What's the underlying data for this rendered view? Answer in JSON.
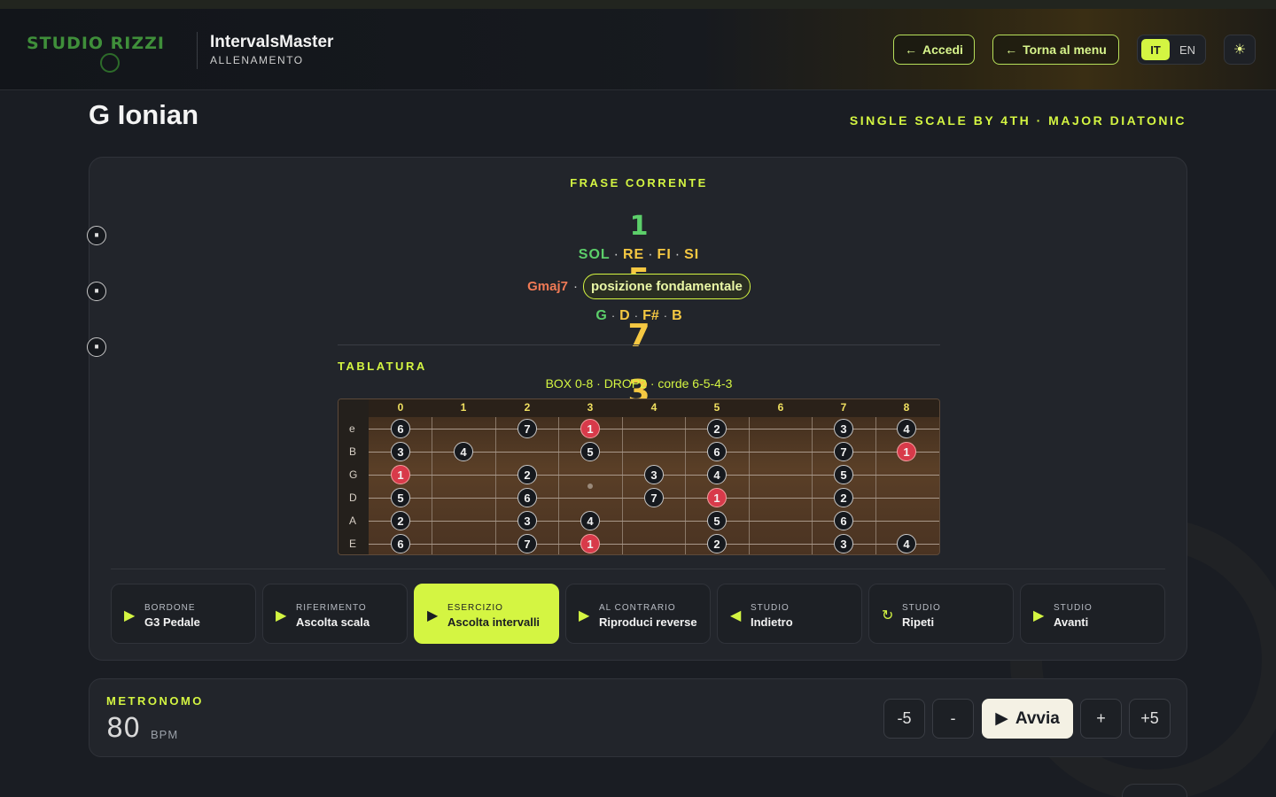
{
  "header": {
    "logo_text": "STUDIO RIZZI",
    "app_title": "IntervalsMaster",
    "app_subtitle": "ALLENAMENTO",
    "login_label": "Accedi",
    "back_label": "Torna al menu",
    "lang_it": "IT",
    "lang_en": "EN",
    "theme_icon": "☀"
  },
  "page": {
    "title": "G Ionian",
    "subtitle": "SINGLE SCALE BY 4TH · MAJOR DIATONIC"
  },
  "phrase": {
    "label": "FRASE CORRENTE",
    "degrees": [
      "1",
      "5",
      "7",
      "3"
    ],
    "solfege": [
      "SOL",
      "RE",
      "FI",
      "SI"
    ],
    "chord_name": "Gmaj7",
    "chord_dot": "·",
    "position": "posizione fondamentale",
    "chord_notes": [
      "G",
      "D",
      "F#",
      "B"
    ]
  },
  "tab": {
    "label": "TABLATURA",
    "info": "BOX 0-8 · DROP2 · corde 6-5-4-3",
    "frets": [
      "0",
      "1",
      "2",
      "3",
      "4",
      "5",
      "6",
      "7",
      "8"
    ],
    "strings": [
      "e",
      "B",
      "G",
      "D",
      "A",
      "E"
    ],
    "notes": [
      {
        "s": 0,
        "f": 0,
        "v": "6"
      },
      {
        "s": 0,
        "f": 2,
        "v": "7"
      },
      {
        "s": 0,
        "f": 3,
        "v": "1",
        "root": true
      },
      {
        "s": 0,
        "f": 5,
        "v": "2"
      },
      {
        "s": 0,
        "f": 7,
        "v": "3"
      },
      {
        "s": 0,
        "f": 8,
        "v": "4"
      },
      {
        "s": 1,
        "f": 0,
        "v": "3"
      },
      {
        "s": 1,
        "f": 1,
        "v": "4"
      },
      {
        "s": 1,
        "f": 3,
        "v": "5"
      },
      {
        "s": 1,
        "f": 5,
        "v": "6"
      },
      {
        "s": 1,
        "f": 7,
        "v": "7"
      },
      {
        "s": 1,
        "f": 8,
        "v": "1",
        "root": true
      },
      {
        "s": 2,
        "f": 0,
        "v": "1",
        "root": true
      },
      {
        "s": 2,
        "f": 2,
        "v": "2"
      },
      {
        "s": 2,
        "f": 4,
        "v": "3"
      },
      {
        "s": 2,
        "f": 5,
        "v": "4"
      },
      {
        "s": 2,
        "f": 7,
        "v": "5"
      },
      {
        "s": 3,
        "f": 0,
        "v": "5"
      },
      {
        "s": 3,
        "f": 2,
        "v": "6"
      },
      {
        "s": 3,
        "f": 4,
        "v": "7"
      },
      {
        "s": 3,
        "f": 5,
        "v": "1",
        "root": true
      },
      {
        "s": 3,
        "f": 7,
        "v": "2"
      },
      {
        "s": 4,
        "f": 0,
        "v": "2"
      },
      {
        "s": 4,
        "f": 2,
        "v": "3"
      },
      {
        "s": 4,
        "f": 3,
        "v": "4"
      },
      {
        "s": 4,
        "f": 5,
        "v": "5"
      },
      {
        "s": 4,
        "f": 7,
        "v": "6"
      },
      {
        "s": 5,
        "f": 0,
        "v": "6"
      },
      {
        "s": 5,
        "f": 2,
        "v": "7"
      },
      {
        "s": 5,
        "f": 3,
        "v": "1",
        "root": true
      },
      {
        "s": 5,
        "f": 5,
        "v": "2"
      },
      {
        "s": 5,
        "f": 7,
        "v": "3"
      },
      {
        "s": 5,
        "f": 8,
        "v": "4"
      }
    ]
  },
  "controls": [
    {
      "icon": "play-icon",
      "glyph": "▶",
      "kicker": "BORDONE",
      "label": "G3 Pedale",
      "active": false
    },
    {
      "icon": "play-icon",
      "glyph": "▶",
      "kicker": "RIFERIMENTO",
      "label": "Ascolta scala",
      "active": false
    },
    {
      "icon": "play-icon",
      "glyph": "▶",
      "kicker": "ESERCIZIO",
      "label": "Ascolta intervalli",
      "active": true
    },
    {
      "icon": "play-icon",
      "glyph": "▶",
      "kicker": "AL CONTRARIO",
      "label": "Riproduci reverse",
      "active": false
    },
    {
      "icon": "back-icon",
      "glyph": "◀",
      "kicker": "STUDIO",
      "label": "Indietro",
      "active": false
    },
    {
      "icon": "repeat-icon",
      "glyph": "↻",
      "kicker": "STUDIO",
      "label": "Ripeti",
      "active": false
    },
    {
      "icon": "play-icon",
      "glyph": "▶",
      "kicker": "STUDIO",
      "label": "Avanti",
      "active": false
    }
  ],
  "metronome": {
    "label": "METRONOMO",
    "bpm": "80",
    "unit": "BPM",
    "minus5": "-5",
    "minus": "-",
    "start": "Avvia",
    "plus": "+",
    "plus5": "+5"
  },
  "colors": {
    "accent": "#d4f542",
    "root": "#d83a4a",
    "tonic": "#5ccf6a",
    "note": "#f5c842",
    "chord": "#f07a55"
  }
}
